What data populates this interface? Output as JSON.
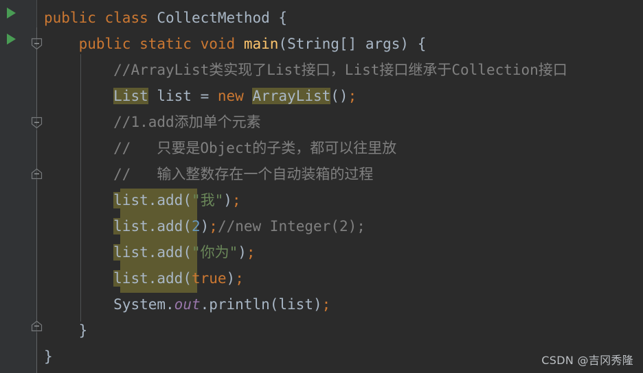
{
  "editor": {
    "language": "java",
    "theme": "darcula",
    "background_color": "#2b2b2b",
    "gutter_color": "#313335",
    "highlight_color": "#5E5A30",
    "colors": {
      "keyword": "#CC7832",
      "identifier": "#A9B7C6",
      "method": "#FFC66D",
      "comment": "#808080",
      "string": "#6A8759",
      "number": "#6897BB",
      "field_static": "#9876AA",
      "run_marker_green": "#499C54"
    },
    "gutter": {
      "run_markers": [
        {
          "name": "run-class-marker",
          "line": 1,
          "tooltip": "Run CollectMethod.main()"
        },
        {
          "name": "run-main-marker",
          "line": 2,
          "tooltip": "Run main()"
        }
      ],
      "fold_markers": [
        {
          "name": "fold-main-method",
          "line": 2,
          "direction": "down",
          "state": "expanded"
        },
        {
          "name": "fold-region-mid",
          "line": 5,
          "direction": "down",
          "state": "expanded"
        },
        {
          "name": "fold-region-end",
          "line": 7,
          "direction": "up",
          "state": "expanded"
        },
        {
          "name": "fold-class-end",
          "line": 13,
          "direction": "up",
          "state": "expanded"
        }
      ]
    },
    "lines": [
      {
        "n": 1,
        "tokens": [
          {
            "t": "public",
            "c": "kw"
          },
          {
            "t": " ",
            "c": "punct"
          },
          {
            "t": "class",
            "c": "kw"
          },
          {
            "t": " ",
            "c": "punct"
          },
          {
            "t": "CollectMethod",
            "c": "type"
          },
          {
            "t": " {",
            "c": "punct"
          }
        ]
      },
      {
        "n": 2,
        "tokens": [
          {
            "t": "    ",
            "c": "punct"
          },
          {
            "t": "public",
            "c": "kw"
          },
          {
            "t": " ",
            "c": "punct"
          },
          {
            "t": "static",
            "c": "kw"
          },
          {
            "t": " ",
            "c": "punct"
          },
          {
            "t": "void",
            "c": "kw"
          },
          {
            "t": " ",
            "c": "punct"
          },
          {
            "t": "main",
            "c": "method"
          },
          {
            "t": "(String[] args) {",
            "c": "punct"
          }
        ]
      },
      {
        "n": 3,
        "tokens": [
          {
            "t": "        ",
            "c": "punct"
          },
          {
            "t": "//ArrayList类实现了List接口，List接口继承于Collection接口",
            "c": "cmt"
          }
        ]
      },
      {
        "n": 4,
        "tokens": [
          {
            "t": "        ",
            "c": "punct"
          },
          {
            "t": "List",
            "c": "type",
            "hl": true
          },
          {
            "t": " list = ",
            "c": "punct"
          },
          {
            "t": "new",
            "c": "kw"
          },
          {
            "t": " ",
            "c": "punct"
          },
          {
            "t": "ArrayList",
            "c": "type",
            "hl": true
          },
          {
            "t": "()",
            "c": "punct"
          },
          {
            "t": ";",
            "c": "semi"
          }
        ]
      },
      {
        "n": 5,
        "tokens": [
          {
            "t": "        ",
            "c": "punct"
          },
          {
            "t": "//1.add添加单个元素",
            "c": "cmt"
          }
        ]
      },
      {
        "n": 6,
        "tokens": [
          {
            "t": "        ",
            "c": "punct"
          },
          {
            "t": "//   只要是Object的子类，都可以往里放",
            "c": "cmt"
          }
        ]
      },
      {
        "n": 7,
        "tokens": [
          {
            "t": "        ",
            "c": "punct"
          },
          {
            "t": "//   输入整数存在一个自动装箱的过程",
            "c": "cmt"
          }
        ]
      },
      {
        "n": 8,
        "tokens": [
          {
            "t": "        ",
            "c": "punct"
          },
          {
            "t": "list.add",
            "c": "ident",
            "hl": true
          },
          {
            "t": "(",
            "c": "punct"
          },
          {
            "t": "\"我\"",
            "c": "str"
          },
          {
            "t": ")",
            "c": "punct"
          },
          {
            "t": ";",
            "c": "semi"
          }
        ]
      },
      {
        "n": 9,
        "tokens": [
          {
            "t": "        ",
            "c": "punct"
          },
          {
            "t": "list.add",
            "c": "ident",
            "hl": true
          },
          {
            "t": "(",
            "c": "punct"
          },
          {
            "t": "2",
            "c": "num"
          },
          {
            "t": ")",
            "c": "punct"
          },
          {
            "t": ";",
            "c": "semi"
          },
          {
            "t": "//new Integer(2);",
            "c": "cmt"
          }
        ]
      },
      {
        "n": 10,
        "tokens": [
          {
            "t": "        ",
            "c": "punct"
          },
          {
            "t": "list.add",
            "c": "ident",
            "hl": true
          },
          {
            "t": "(",
            "c": "punct"
          },
          {
            "t": "\"你为\"",
            "c": "str"
          },
          {
            "t": ")",
            "c": "punct"
          },
          {
            "t": ";",
            "c": "semi"
          }
        ]
      },
      {
        "n": 11,
        "tokens": [
          {
            "t": "        ",
            "c": "punct"
          },
          {
            "t": "list.add",
            "c": "ident",
            "hl": true
          },
          {
            "t": "(",
            "c": "punct"
          },
          {
            "t": "true",
            "c": "kw"
          },
          {
            "t": ")",
            "c": "punct"
          },
          {
            "t": ";",
            "c": "semi"
          }
        ]
      },
      {
        "n": 12,
        "tokens": [
          {
            "t": "        ",
            "c": "punct"
          },
          {
            "t": "System.",
            "c": "ident"
          },
          {
            "t": "out",
            "c": "field"
          },
          {
            "t": ".println(list)",
            "c": "ident"
          },
          {
            "t": ";",
            "c": "semi"
          }
        ]
      },
      {
        "n": 13,
        "tokens": [
          {
            "t": "    }",
            "c": "punct"
          }
        ]
      },
      {
        "n": 14,
        "tokens": [
          {
            "t": "}",
            "c": "punct"
          }
        ]
      }
    ]
  },
  "watermark": {
    "text": "CSDN @吉冈秀隆"
  }
}
